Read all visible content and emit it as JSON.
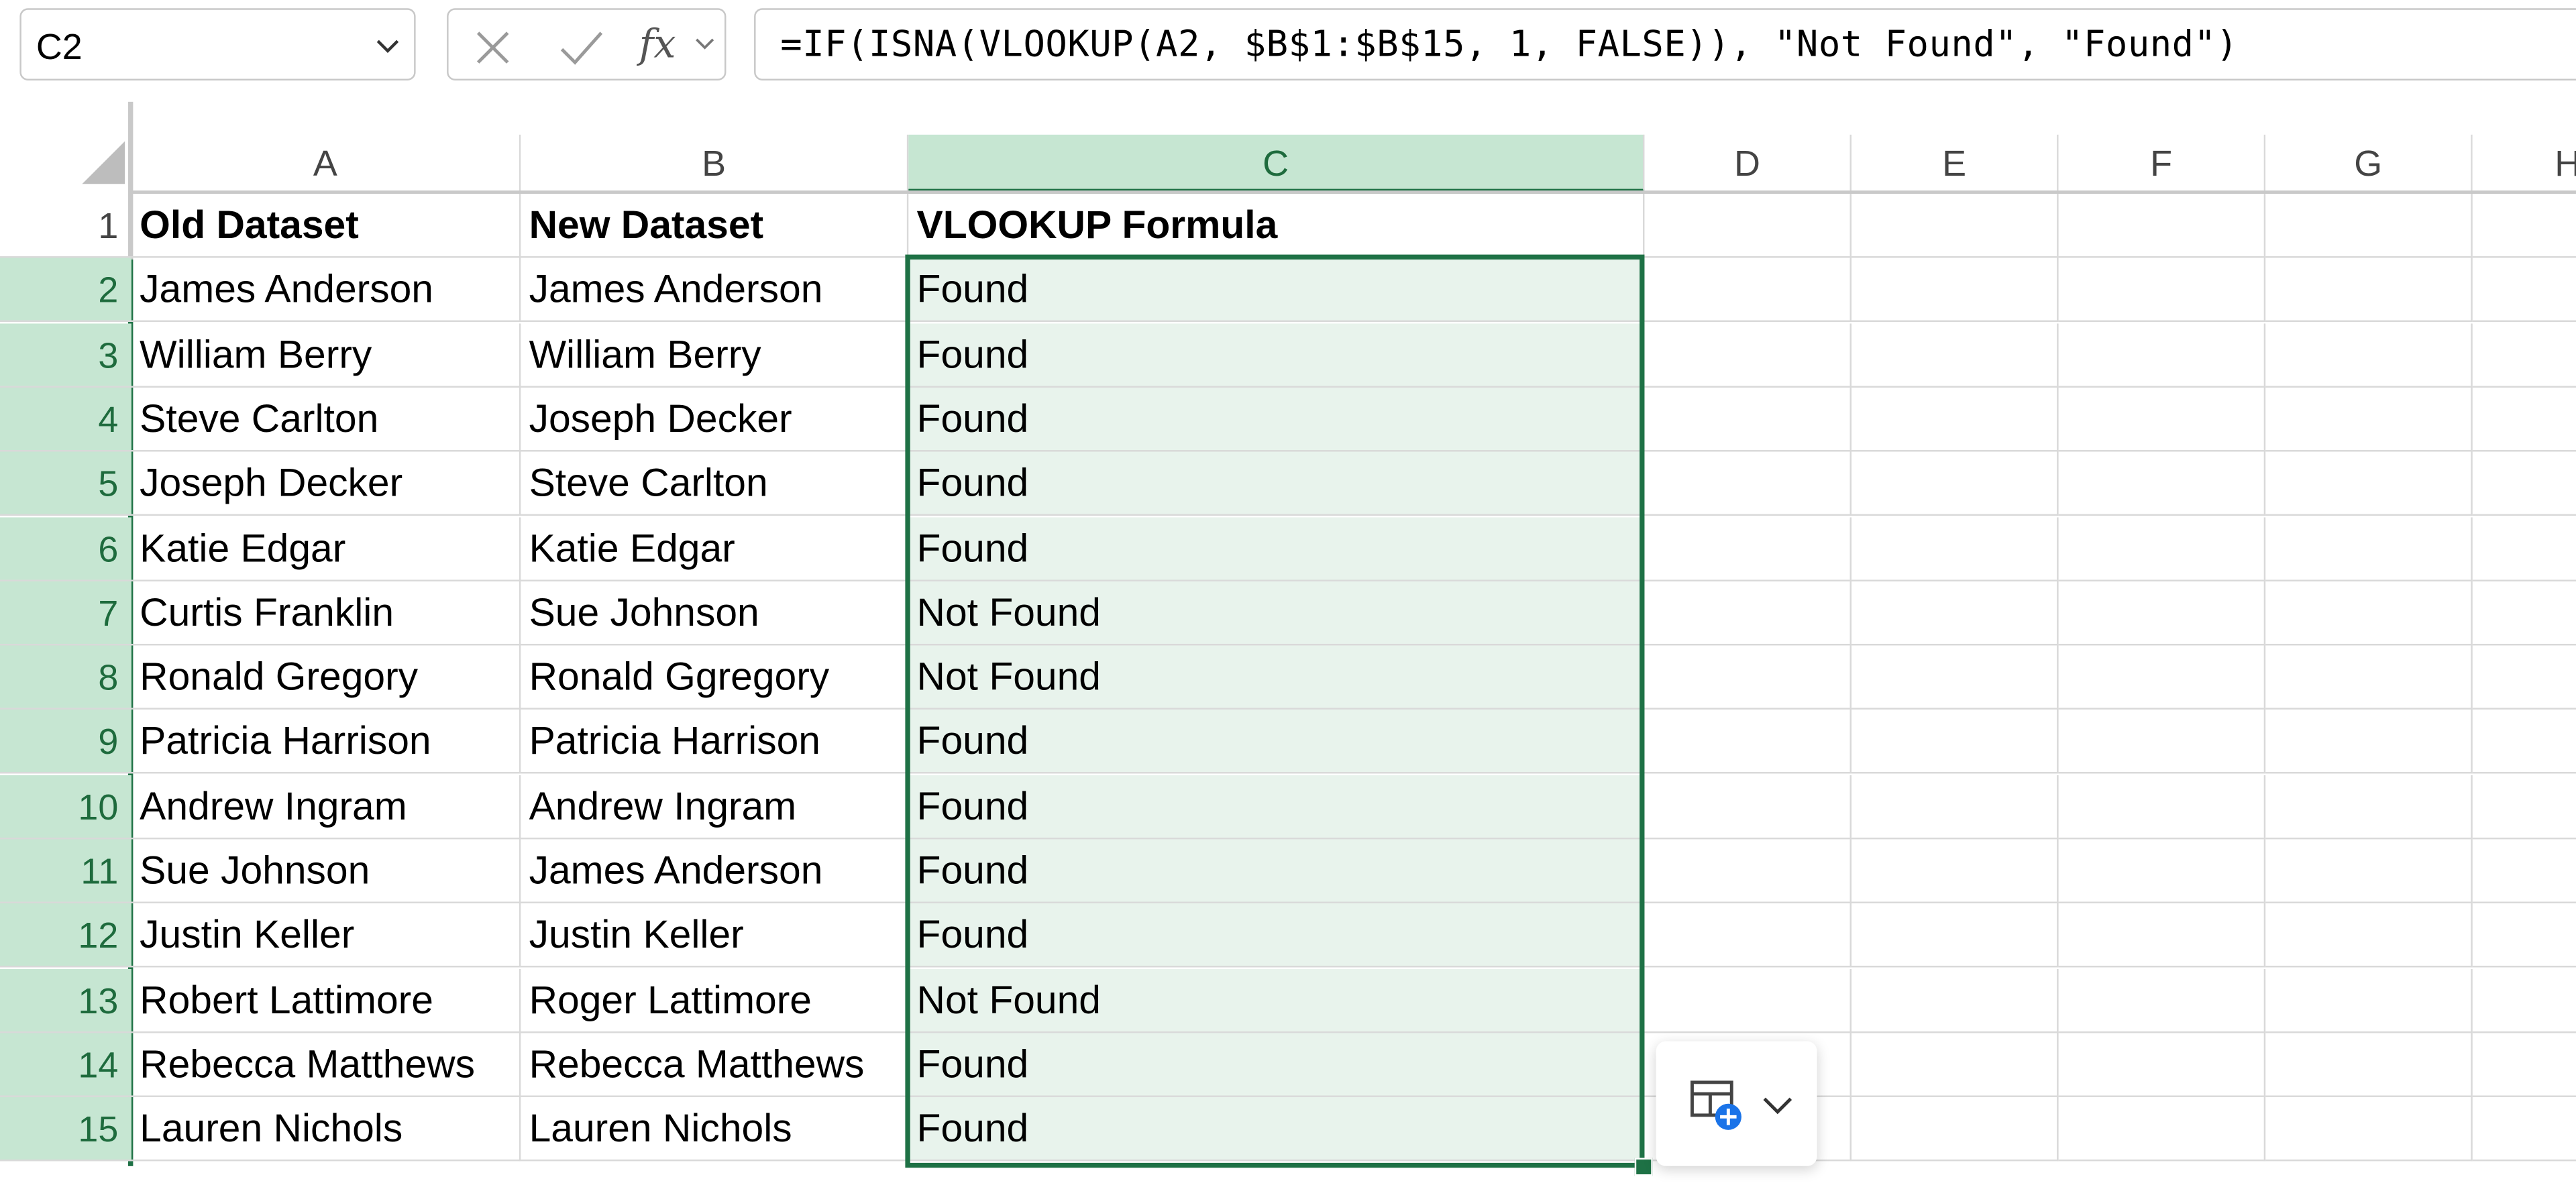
{
  "namebox": {
    "value": "C2"
  },
  "formula_bar": {
    "fx_label": "fx",
    "formula": "=IF(ISNA(VLOOKUP(A2, $B$1:$B$15, 1, FALSE)), \"Not Found\", \"Found\")"
  },
  "columns": [
    "A",
    "B",
    "C",
    "D",
    "E",
    "F",
    "G",
    "H"
  ],
  "selected_column": "C",
  "rows": [
    {
      "num": "1",
      "a": "Old Dataset",
      "b": "New Dataset",
      "c": "VLOOKUP Formula"
    },
    {
      "num": "2",
      "a": "James Anderson",
      "b": "James Anderson",
      "c": "Found"
    },
    {
      "num": "3",
      "a": "William Berry",
      "b": "William Berry",
      "c": "Found"
    },
    {
      "num": "4",
      "a": "Steve Carlton",
      "b": "Joseph Decker",
      "c": "Found"
    },
    {
      "num": "5",
      "a": "Joseph Decker",
      "b": "Steve Carlton",
      "c": "Found"
    },
    {
      "num": "6",
      "a": "Katie Edgar",
      "b": "Katie Edgar",
      "c": "Found"
    },
    {
      "num": "7",
      "a": "Curtis Franklin",
      "b": "Sue Johnson",
      "c": "Not Found"
    },
    {
      "num": "8",
      "a": "Ronald Gregory",
      "b": "Ronald Ggregory",
      "c": "Not Found"
    },
    {
      "num": "9",
      "a": "Patricia Harrison",
      "b": "Patricia Harrison",
      "c": "Found"
    },
    {
      "num": "10",
      "a": "Andrew Ingram",
      "b": "Andrew Ingram",
      "c": "Found"
    },
    {
      "num": "11",
      "a": "Sue Johnson",
      "b": "James Anderson",
      "c": "Found"
    },
    {
      "num": "12",
      "a": "Justin Keller",
      "b": "Justin Keller",
      "c": "Found"
    },
    {
      "num": "13",
      "a": "Robert Lattimore",
      "b": "Roger Lattimore",
      "c": "Not Found"
    },
    {
      "num": "14",
      "a": "Rebecca Matthews",
      "b": "Rebecca Matthews",
      "c": "Found"
    },
    {
      "num": "15",
      "a": "Lauren Nichols",
      "b": "Lauren Nichols",
      "c": "Found"
    }
  ],
  "colors": {
    "accent": "#1e7145",
    "selection_fill": "#e8f3ec",
    "header_selected": "#c6e6d2"
  },
  "icons": {
    "namebox_dropdown": "chevron-down-icon",
    "cancel": "close-icon",
    "enter": "check-icon",
    "function": "function-icon",
    "quick_analysis": "quick-analysis-icon"
  }
}
